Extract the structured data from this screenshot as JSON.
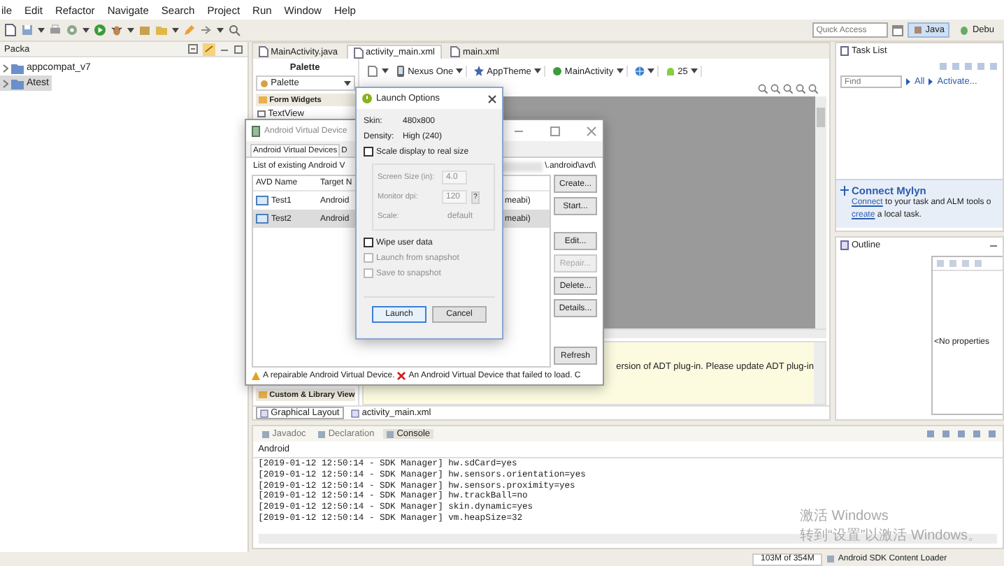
{
  "menu_bar": {
    "items": [
      "ile",
      "Edit",
      "Refactor",
      "Navigate",
      "Search",
      "Project",
      "Run",
      "Window",
      "Help"
    ]
  },
  "toolbar": {
    "quick_access": {
      "placeholder": "Quick Access"
    },
    "perspectives": [
      {
        "label": "Java",
        "selected": true
      },
      {
        "label": "Debu",
        "selected": false
      }
    ]
  },
  "package_explorer": {
    "tab": "Packa",
    "tree": [
      {
        "label": "appcompat_v7",
        "selected": false
      },
      {
        "label": "Atest",
        "selected": true
      }
    ]
  },
  "editor": {
    "tabs": [
      {
        "label": "MainActivity.java",
        "selected": false
      },
      {
        "label": "activity_main.xml",
        "selected": true
      },
      {
        "label": "main.xml",
        "selected": false
      }
    ],
    "palette": {
      "title": "Palette",
      "dropdown": "Palette",
      "items": [
        {
          "kind": "category",
          "label": "Form Widgets"
        },
        {
          "kind": "widget",
          "label": "TextView"
        }
      ],
      "bottom_category": "Custom & Library View"
    },
    "layout_toolbar": [
      {
        "kind": "device",
        "label": "Nexus One"
      },
      {
        "kind": "theme",
        "label": "AppTheme"
      },
      {
        "kind": "activity",
        "label": "MainActivity"
      },
      {
        "kind": "locale"
      },
      {
        "kind": "api",
        "label": "25"
      }
    ],
    "message": "ersion of ADT plug-in. Please update ADT plug-in",
    "bottom_tabs": [
      {
        "label": "Graphical Layout",
        "selected": true
      },
      {
        "label": "activity_main.xml",
        "selected": false
      }
    ]
  },
  "task_list": {
    "tab": "Task List",
    "find": {
      "placeholder": "Find"
    },
    "links": [
      "All",
      "Activate..."
    ],
    "mylyn": {
      "title": "Connect Mylyn",
      "link": "Connect",
      "text": "to your task and ALM tools o",
      "link2": "create",
      "text2": "a local task."
    }
  },
  "outline": {
    "tab": "Outline",
    "message": "<No properties"
  },
  "console": {
    "tabs": [
      {
        "label": "Javadoc",
        "selected": false
      },
      {
        "label": "Declaration",
        "selected": false
      },
      {
        "label": "Console",
        "selected": true
      }
    ],
    "title": "Android",
    "lines": [
      "[2019-01-12 12:50:14 - SDK Manager] hw.sdCard=yes",
      "[2019-01-12 12:50:14 - SDK Manager] hw.sensors.orientation=yes",
      "[2019-01-12 12:50:14 - SDK Manager] hw.sensors.proximity=yes",
      "[2019-01-12 12:50:14 - SDK Manager] hw.trackBall=no",
      "[2019-01-12 12:50:14 - SDK Manager] skin.dynamic=yes",
      "[2019-01-12 12:50:14 - SDK Manager] vm.heapSize=32"
    ]
  },
  "status_bar": {
    "memory": "103M of 354M",
    "job": "Android SDK Content Loader"
  },
  "os_notice": {
    "title": "激活 Windows",
    "text": "转到“设置”以激活 Windows。"
  },
  "avd_manager": {
    "title": "Android Virtual Device",
    "tabs": [
      {
        "label": "Android Virtual Devices",
        "selected": true
      },
      {
        "label": "D",
        "selected": false
      }
    ],
    "list_label": "List of existing Android V",
    "path": "\\.android\\avd\\",
    "columns": [
      "AVD Name",
      "Target N"
    ],
    "rows": [
      {
        "name": "Test1",
        "target": "Android",
        "abi": "meabi)",
        "selected": false
      },
      {
        "name": "Test2",
        "target": "Android",
        "abi": "meabi)",
        "selected": true
      }
    ],
    "buttons": [
      {
        "label": "Create...",
        "kind": "launch",
        "disabled": false
      },
      {
        "label": "Start...",
        "kind": "launch",
        "disabled": false
      },
      {
        "label": "Edit...",
        "kind": "manage",
        "disabled": false
      },
      {
        "label": "Repair...",
        "kind": "manage",
        "disabled": true
      },
      {
        "label": "Delete...",
        "kind": "manage",
        "disabled": false
      },
      {
        "label": "Details...",
        "kind": "manage",
        "disabled": false
      },
      {
        "label": "Refresh",
        "kind": "refresh",
        "disabled": false
      }
    ],
    "legend": [
      {
        "kind": "warning",
        "text": "A repairable Android Virtual Device."
      },
      {
        "kind": "error",
        "text": "An Android Virtual Device that failed to load. C"
      }
    ]
  },
  "launch_options": {
    "title": "Launch Options",
    "info": [
      {
        "label": "Skin:",
        "value": "480x800"
      },
      {
        "label": "Density:",
        "value": "High (240)"
      }
    ],
    "scale_display": {
      "label": "Scale display to real size",
      "checked": false
    },
    "scale_fields": [
      {
        "kind": "field",
        "label": "Screen Size (in):",
        "value": "4.0",
        "disabled": true
      },
      {
        "kind": "field",
        "label": "Monitor dpi:",
        "value": "120",
        "disabled": true,
        "help": "?"
      },
      {
        "kind": "text",
        "label": "Scale:",
        "value": "default",
        "disabled": true
      }
    ],
    "options": [
      {
        "label": "Wipe user data",
        "checked": false,
        "disabled": false
      },
      {
        "label": "Launch from snapshot",
        "checked": false,
        "disabled": true
      },
      {
        "label": "Save to snapshot",
        "checked": false,
        "disabled": true
      }
    ],
    "buttons": [
      {
        "label": "Launch",
        "default": true
      },
      {
        "label": "Cancel",
        "default": false
      }
    ]
  }
}
